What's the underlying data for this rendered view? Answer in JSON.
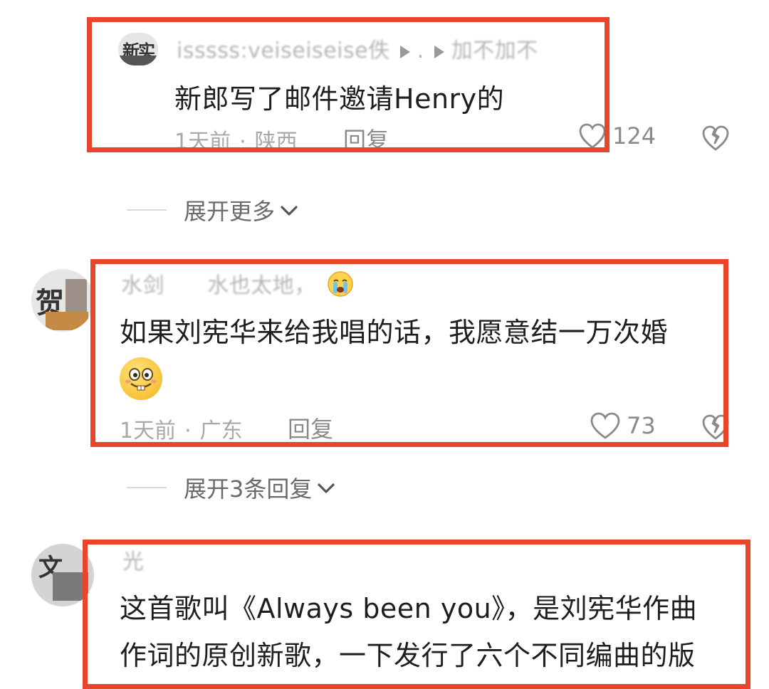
{
  "comments": [
    {
      "username_a": "isssss:veiseiseise佚",
      "username_b": ".",
      "username_c": "加不加不",
      "text": "新郎写了邮件邀请Henry的",
      "time": "1天前",
      "location": "陕西",
      "reply": "回复",
      "likes": "124",
      "avatar_label": "新实"
    },
    {
      "username_a": "水剑",
      "username_b": "水也太地，",
      "text": "如果刘宪华来给我唱的话，我愿意结一万次婚",
      "time": "1天前",
      "location": "广东",
      "reply": "回复",
      "likes": "73",
      "avatar_label": "贺"
    },
    {
      "username_a": "光",
      "text_line1": "这首歌叫《Always been you》，是刘宪华作曲",
      "text_line2": "作词的原创新歌，一下发行了六个不同编曲的版",
      "avatar_label": "文"
    }
  ],
  "expand_more": "展开更多",
  "expand_replies": "展开3条回复",
  "colors": {
    "highlight": "#e8452c",
    "meta": "#a8a8a8",
    "text": "#1e1e1e"
  },
  "icons": [
    "heart-icon",
    "broken-heart-icon",
    "chevron-down-icon",
    "crying-emoji-icon",
    "grin-emoji-icon"
  ]
}
